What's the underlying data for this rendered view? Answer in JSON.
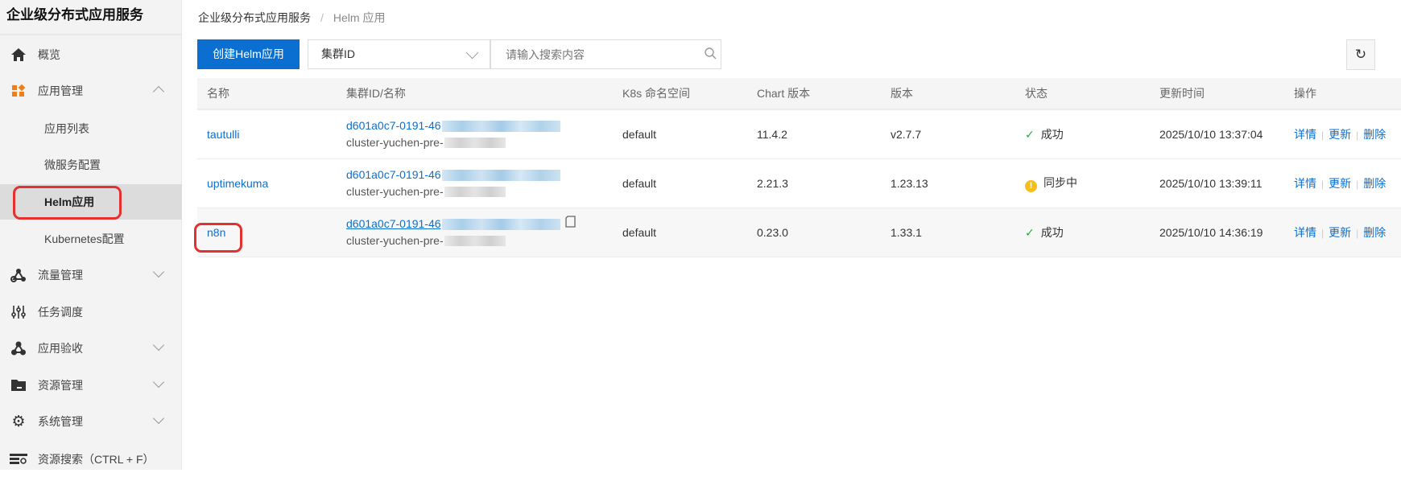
{
  "sidebar": {
    "title": "企业级分布式应用服务",
    "items": [
      {
        "label": "概览",
        "icon": "home-icon"
      },
      {
        "label": "应用管理",
        "icon": "apps-icon"
      },
      {
        "label": "应用列表"
      },
      {
        "label": "微服务配置"
      },
      {
        "label": "Helm应用"
      },
      {
        "label": "Kubernetes配置"
      },
      {
        "label": "流量管理",
        "icon": "traffic-icon"
      },
      {
        "label": "任务调度",
        "icon": "sliders-icon"
      },
      {
        "label": "应用验收",
        "icon": "acceptance-icon"
      },
      {
        "label": "资源管理",
        "icon": "folder-icon"
      },
      {
        "label": "系统管理",
        "icon": "gear-icon"
      },
      {
        "label": "资源搜索（CTRL + F）",
        "icon": "resource-search-icon"
      }
    ]
  },
  "breadcrumb": {
    "root": "企业级分布式应用服务",
    "sep": "/",
    "current": "Helm 应用"
  },
  "toolbar": {
    "create_label": "创建Helm应用",
    "select_value": "集群ID",
    "search_placeholder": "请输入搜索内容"
  },
  "table": {
    "headers": [
      "名称",
      "集群ID/名称",
      "K8s 命名空间",
      "Chart 版本",
      "版本",
      "状态",
      "更新时间",
      "操作"
    ],
    "rows": [
      {
        "name": "tautulli",
        "cluster_id": "d601a0c7-0191-46",
        "cluster_name": "cluster-yuchen-pre-",
        "namespace": "default",
        "chart": "11.4.2",
        "version": "v2.7.7",
        "status": "成功",
        "time": "2025/10/10 13:37:04"
      },
      {
        "name": "uptimekuma",
        "cluster_id": "d601a0c7-0191-46",
        "cluster_name": "cluster-yuchen-pre-",
        "namespace": "default",
        "chart": "2.21.3",
        "version": "1.23.13",
        "status": "同步中",
        "time": "2025/10/10 13:39:11"
      },
      {
        "name": "n8n",
        "cluster_id": "d601a0c7-0191-46",
        "cluster_name": "cluster-yuchen-pre-",
        "namespace": "default",
        "chart": "0.23.0",
        "version": "1.33.1",
        "status": "成功",
        "time": "2025/10/10 14:36:19"
      }
    ],
    "ops": {
      "detail": "详情",
      "update": "更新",
      "delete": "删除",
      "sep": "|"
    }
  },
  "colors": {
    "primary": "#0a6fd0",
    "success": "#1fab3d",
    "warning": "#f5be18",
    "highlight": "#e2312f"
  }
}
